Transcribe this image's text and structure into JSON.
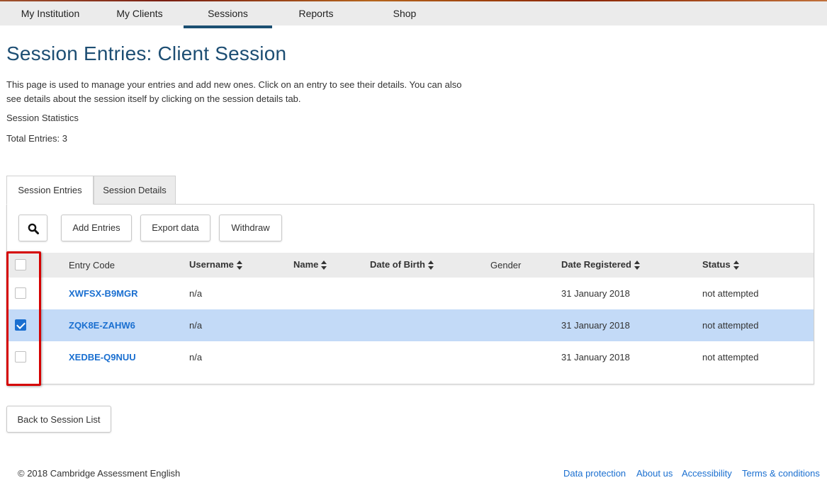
{
  "nav": {
    "items": [
      {
        "label": "My Institution"
      },
      {
        "label": "My Clients"
      },
      {
        "label": "Sessions"
      },
      {
        "label": "Reports"
      },
      {
        "label": "Shop"
      }
    ],
    "active": "Sessions"
  },
  "page": {
    "title": "Session Entries: Client Session",
    "description": "This page is used to manage your entries and add new ones. Click on an entry to see their details. You can also see details about the session itself by clicking on the session details tab.",
    "stats_label": "Session Statistics",
    "total_entries": "Total Entries: 3"
  },
  "tabs": [
    {
      "label": "Session Entries",
      "active": true
    },
    {
      "label": "Session Details",
      "active": false
    }
  ],
  "toolbar": {
    "search_icon": "search-icon",
    "add_label": "Add Entries",
    "export_label": "Export data",
    "withdraw_label": "Withdraw"
  },
  "table": {
    "columns": [
      "Entry Code",
      "Username",
      "Name",
      "Date of Birth",
      "Gender",
      "Date Registered",
      "Status"
    ],
    "rows": [
      {
        "code": "XWFSX-B9MGR",
        "username": "n/a",
        "name": "",
        "dob": "",
        "gender": "",
        "registered": "31 January 2018",
        "status": "not attempted",
        "checked": false
      },
      {
        "code": "ZQK8E-ZAHW6",
        "username": "n/a",
        "name": "",
        "dob": "",
        "gender": "",
        "registered": "31 January 2018",
        "status": "not attempted",
        "checked": true
      },
      {
        "code": "XEDBE-Q9NUU",
        "username": "n/a",
        "name": "",
        "dob": "",
        "gender": "",
        "registered": "31 January 2018",
        "status": "not attempted",
        "checked": false
      }
    ]
  },
  "back_button": "Back to Session List",
  "footer": {
    "copyright": "© 2018 Cambridge Assessment English",
    "links": [
      "Data protection",
      "About us",
      "Accessibility",
      "Terms & conditions"
    ]
  },
  "colors": {
    "title": "#1d4e73",
    "link": "#1a6fd0",
    "selected_row": "#c3daf7",
    "highlight": "#d50000",
    "nav_active": "#1b4f72"
  }
}
